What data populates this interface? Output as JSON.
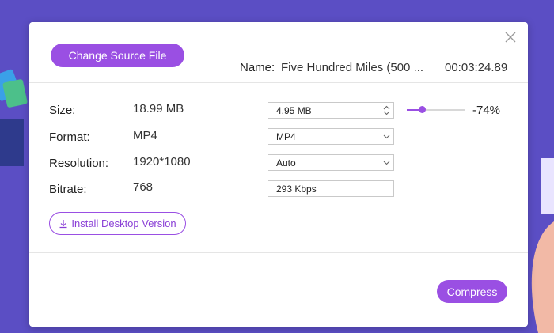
{
  "dialog": {
    "change_source_label": "Change Source File",
    "name_label": "Name:",
    "file_name": "Five Hundred Miles (500 ...",
    "duration": "00:03:24.89"
  },
  "rows": {
    "size": {
      "label": "Size:",
      "original": "18.99 MB",
      "target": "4.95  MB"
    },
    "format": {
      "label": "Format:",
      "original": "MP4",
      "target": "MP4"
    },
    "resolution": {
      "label": "Resolution:",
      "original": "1920*1080",
      "target": "Auto"
    },
    "bitrate": {
      "label": "Bitrate:",
      "original": "768",
      "target": "293 Kbps"
    }
  },
  "compression": {
    "percent_label": "-74%",
    "slider_value_fraction": 0.26
  },
  "install_label": "Install Desktop Version",
  "compress_label": "Compress",
  "colors": {
    "accent": "#9a4fe3",
    "background": "#5b4ec4"
  },
  "icons": [
    "close-icon",
    "spinner-arrows-icon",
    "chevron-down-icon",
    "download-icon"
  ]
}
